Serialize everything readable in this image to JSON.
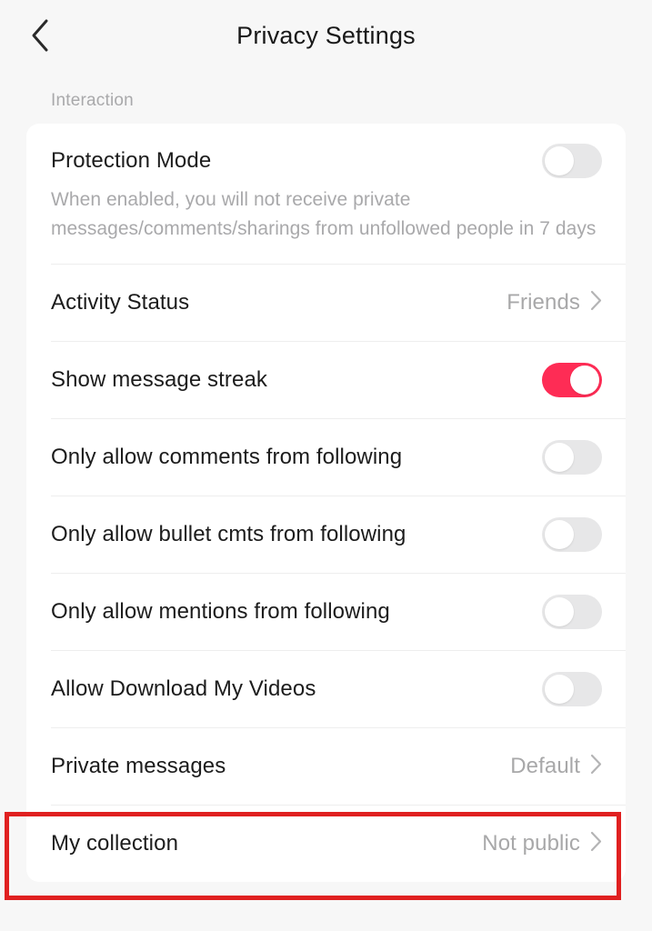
{
  "header": {
    "title": "Privacy Settings",
    "back_icon": "chevron-left-icon"
  },
  "section": {
    "label": "Interaction"
  },
  "rows": [
    {
      "label": "Protection Mode",
      "description": "When enabled, you will not receive private messages/comments/sharings from unfollowed people in 7 days",
      "control": "toggle",
      "state": "off"
    },
    {
      "label": "Activity Status",
      "control": "value",
      "value": "Friends",
      "chevron": "chevron-right-icon"
    },
    {
      "label": "Show message streak",
      "control": "toggle",
      "state": "on"
    },
    {
      "label": "Only allow comments from following",
      "control": "toggle",
      "state": "off"
    },
    {
      "label": "Only allow bullet cmts from following",
      "control": "toggle",
      "state": "off"
    },
    {
      "label": "Only allow mentions from following",
      "control": "toggle",
      "state": "off"
    },
    {
      "label": "Allow Download My Videos",
      "control": "toggle",
      "state": "off"
    },
    {
      "label": "Private messages",
      "control": "value",
      "value": "Default",
      "chevron": "chevron-right-icon"
    },
    {
      "label": "My collection",
      "control": "value",
      "value": "Not public",
      "chevron": "chevron-right-icon",
      "highlighted": true
    }
  ],
  "colors": {
    "accent_on": "#fe2c55",
    "toggle_off": "#e7e7e8",
    "annotation": "#e02020",
    "page_bg": "#f7f7f7",
    "card_bg": "#ffffff",
    "label_text": "#1c1c1c",
    "muted_text": "#a9a9ab"
  }
}
